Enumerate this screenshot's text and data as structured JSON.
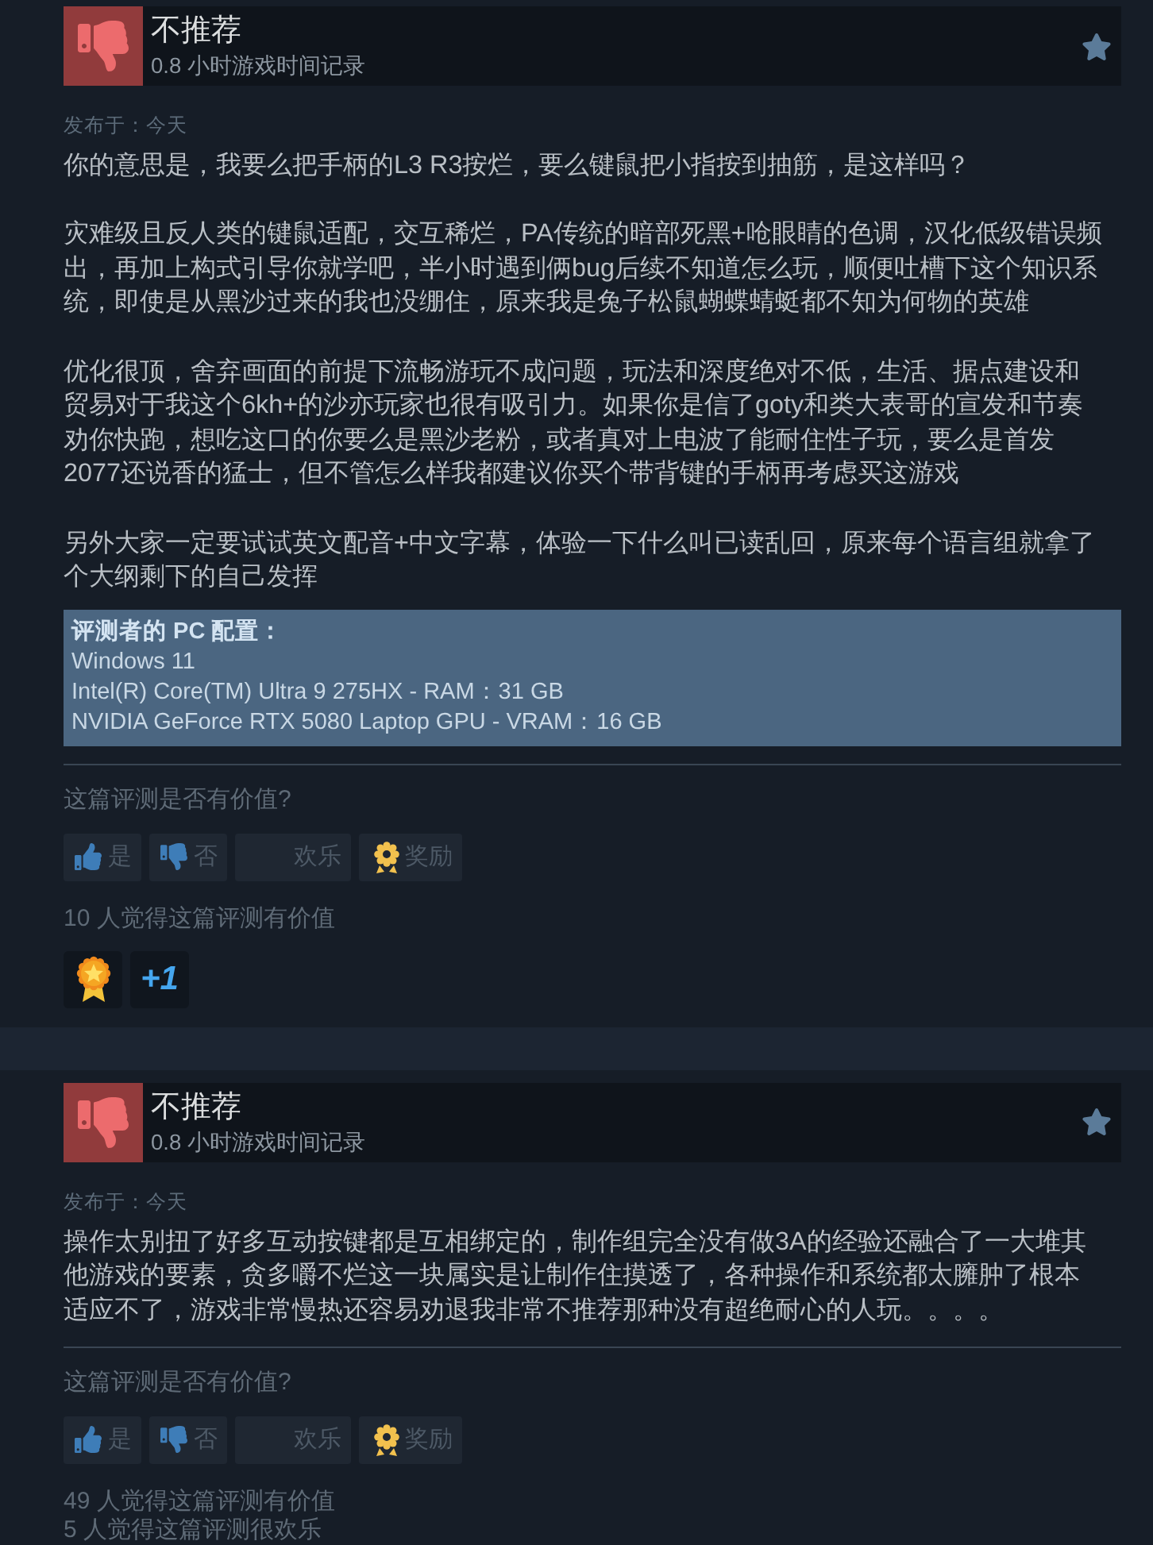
{
  "reviews": [
    {
      "recommended": false,
      "verdict": "不推荐",
      "hours": "0.8 小时游戏时间记录",
      "posted": "发布于：今天",
      "paragraphs": [
        [
          "你的意思是，我要么把手柄的L3 R3按烂，要么键鼠把小指按到抽筋，是这样吗？"
        ],
        [
          "灾难级且反人类的键鼠适配，交互稀烂，PA传统的暗部死黑+呛眼睛的色调，汉化低级错误频",
          "出，再加上构式引导你就学吧，半小时遇到俩bug后续不知道怎么玩，顺便吐槽下这个知识系",
          "统，即使是从黑沙过来的我也没绷住，原来我是兔子松鼠蝴蝶蜻蜓都不知为何物的英雄"
        ],
        [
          "优化很顶，舍弃画面的前提下流畅游玩不成问题，玩法和深度绝对不低，生活、据点建设和",
          "贸易对于我这个6kh+的沙亦玩家也很有吸引力。如果你是信了goty和类大表哥的宣发和节奏",
          "劝你快跑，想吃这口的你要么是黑沙老粉，或者真对上电波了能耐住性子玩，要么是首发",
          "2077还说香的猛士，但不管怎么样我都建议你买个带背键的手柄再考虑买这游戏"
        ],
        [
          "另外大家一定要试试英文配音+中文字幕，体验一下什么叫已读乱回，原来每个语言组就拿了",
          "个大纲剩下的自己发挥"
        ]
      ],
      "specs": {
        "title": "评测者的 PC 配置：",
        "lines": [
          "Windows 11",
          "Intel(R) Core(TM) Ultra 9 275HX - RAM：31 GB",
          "NVIDIA GeForce RTX 5080 Laptop GPU - VRAM：16 GB"
        ]
      },
      "question": "这篇评测是否有价值?",
      "buttons": [
        {
          "kind": "yes",
          "label": "是"
        },
        {
          "kind": "no",
          "label": "否"
        },
        {
          "kind": "funny",
          "label": "欢乐"
        },
        {
          "kind": "award",
          "label": "奖励"
        }
      ],
      "tallies": [
        "10 人觉得这篇评测有价值"
      ],
      "awards": [
        {
          "kind": "medal"
        },
        {
          "kind": "plus-one",
          "label": "+1"
        }
      ]
    },
    {
      "recommended": false,
      "verdict": "不推荐",
      "hours": "0.8 小时游戏时间记录",
      "posted": "发布于：今天",
      "paragraphs": [
        [
          "操作太别扭了好多互动按键都是互相绑定的，制作组完全没有做3A的经验还融合了一大堆其",
          "他游戏的要素，贪多嚼不烂这一块属实是让制作住摸透了，各种操作和系统都太臃肿了根本",
          "适应不了，游戏非常慢热还容易劝退我非常不推荐那种没有超绝耐心的人玩。。。。"
        ]
      ],
      "question": "这篇评测是否有价值?",
      "buttons": [
        {
          "kind": "yes",
          "label": "是"
        },
        {
          "kind": "no",
          "label": "否"
        },
        {
          "kind": "funny",
          "label": "欢乐"
        },
        {
          "kind": "award",
          "label": "奖励"
        }
      ],
      "tallies": [
        "49 人觉得这篇评测有价值",
        "5 人觉得这篇评测很欢乐"
      ]
    }
  ]
}
